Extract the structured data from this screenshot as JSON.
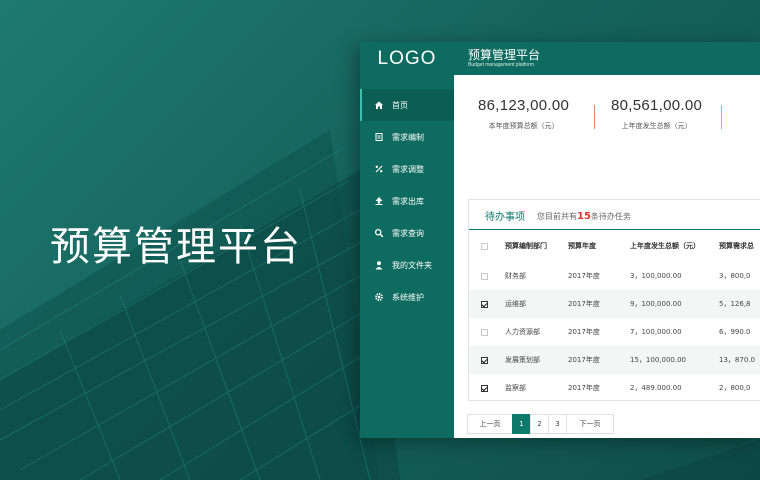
{
  "hero": {
    "title": "预算管理平台"
  },
  "app": {
    "logo": "LOGO",
    "title": "预算管理平台",
    "subtitle": "Budget management platform"
  },
  "sidebar": {
    "items": [
      {
        "label": "首页",
        "icon": "home-icon",
        "active": true
      },
      {
        "label": "需求编制",
        "icon": "document-icon"
      },
      {
        "label": "需求调整",
        "icon": "percent-icon"
      },
      {
        "label": "需求出库",
        "icon": "upload-icon"
      },
      {
        "label": "需求查询",
        "icon": "search-icon"
      },
      {
        "label": "我的文件夹",
        "icon": "user-icon"
      },
      {
        "label": "系统维护",
        "icon": "gear-icon"
      }
    ]
  },
  "stats": [
    {
      "value": "86,123,00.00",
      "label": "本年度预算总额（元）",
      "accent": "#e08a5a"
    },
    {
      "value": "80,561,00.00",
      "label": "上年度发生总额（元）",
      "accent": "#6ec6d6"
    }
  ],
  "todo": {
    "tab_label": "待办事项",
    "summary_prefix": "您目前共有",
    "count": "15",
    "summary_suffix": "条待办任务",
    "columns": [
      "预算编制部门",
      "预算年度",
      "上年度发生总额（元）",
      "预算需求总"
    ],
    "rows": [
      {
        "checked": false,
        "dept": "财务部",
        "year": "2017年度",
        "prev": "3，100,000.00",
        "req": "3，800,0"
      },
      {
        "checked": true,
        "dept": "运维部",
        "year": "2017年度",
        "prev": "9，100,000.00",
        "req": "5，126,8"
      },
      {
        "checked": false,
        "dept": "人力资源部",
        "year": "2017年度",
        "prev": "7，100,000.00",
        "req": "6，990.0"
      },
      {
        "checked": true,
        "dept": "发展策划部",
        "year": "2017年度",
        "prev": "15，100,000.00",
        "req": "13，870.0"
      },
      {
        "checked": true,
        "dept": "监察部",
        "year": "2017年度",
        "prev": "2，489.000.00",
        "req": "2，800,0"
      }
    ]
  },
  "pager": {
    "prev_label": "上一页",
    "pages": [
      "1",
      "2",
      "3"
    ],
    "current": "1",
    "next_label": "下一页"
  },
  "colors": {
    "brand": "#0d6b5f",
    "accent": "#0d7a6b",
    "highlight": "#d9362b"
  }
}
